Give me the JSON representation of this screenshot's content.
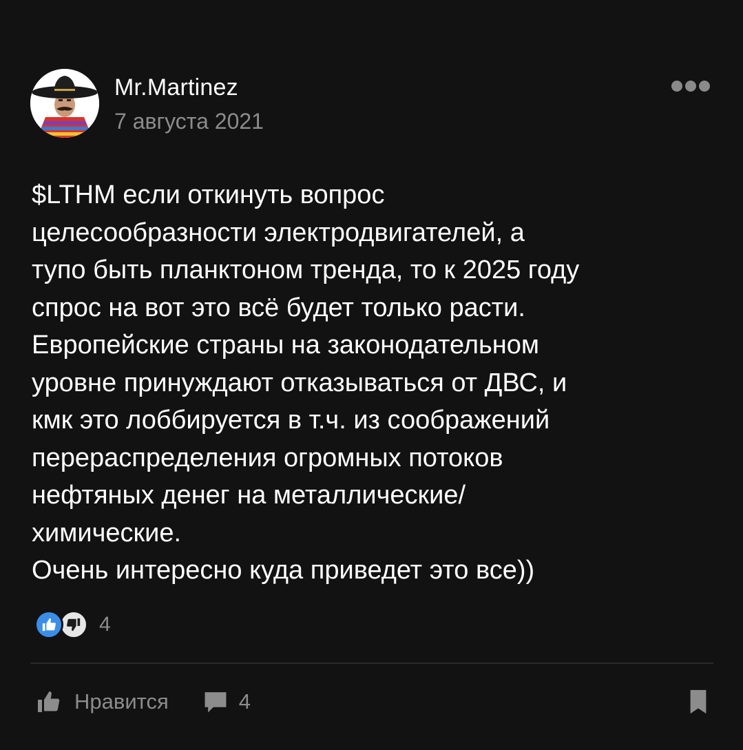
{
  "post": {
    "author": "Mr.Martinez",
    "date": "7 августа 2021",
    "text": "$LTHM если откинуть вопрос\nцелесообразности электродвигателей, а\nтупо быть планктоном тренда, то к 2025 году\nспрос на вот это всё будет только расти.\nЕвропейские страны на законодательном\nуровне принуждают отказываться от ДВС, и\nкмк это лоббируется в т.ч. из соображений\nперераспределения огромных потоков\nнефтяных денег на металлические/\nхимические.\nОчень интересно куда приведет это все))",
    "reactions": {
      "icons": [
        "thumbs-up-icon",
        "thumbs-down-icon"
      ],
      "count": "4"
    }
  },
  "actions": {
    "like_label": "Нравится",
    "comments_count": "4"
  },
  "colors": {
    "background": "#121212",
    "text": "#ffffff",
    "secondary": "#8c8c8c",
    "like_reaction": "#3b8ee8",
    "divider": "#2a2a2a"
  }
}
